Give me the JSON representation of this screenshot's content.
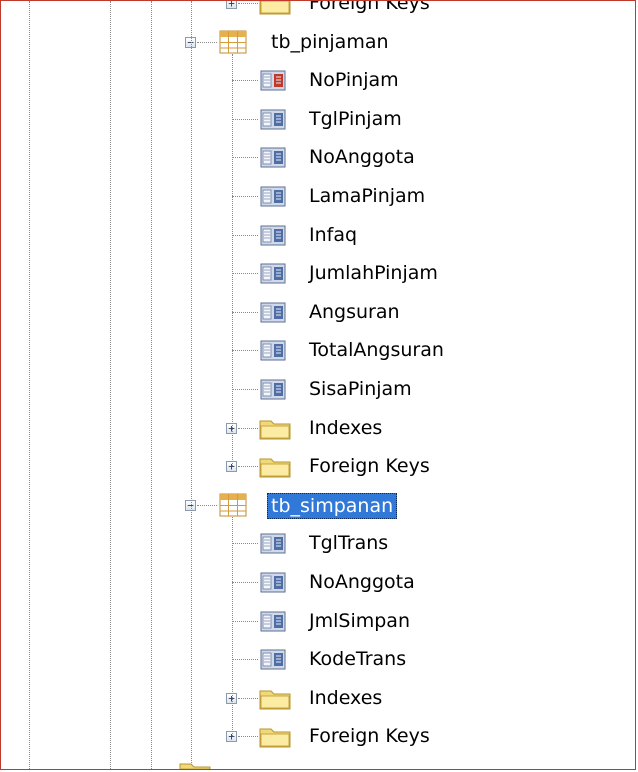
{
  "tree": {
    "top_partial": {
      "label": "Foreign Keys"
    },
    "tables": [
      {
        "name": "tb_pinjaman",
        "selected": false,
        "columns": [
          "NoPinjam",
          "TglPinjam",
          "NoAnggota",
          "LamaPinjam",
          "Infaq",
          "JumlahPinjam",
          "Angsuran",
          "TotalAngsuran",
          "SisaPinjam"
        ],
        "folders": [
          "Indexes",
          "Foreign Keys"
        ]
      },
      {
        "name": "tb_simpanan",
        "selected": true,
        "columns": [
          "TglTrans",
          "NoAnggota",
          "JmlSimpan",
          "KodeTrans"
        ],
        "folders": [
          "Indexes",
          "Foreign Keys"
        ]
      }
    ]
  },
  "colors": {
    "selection": "#3079d8",
    "frame_border": "#c0392b"
  }
}
